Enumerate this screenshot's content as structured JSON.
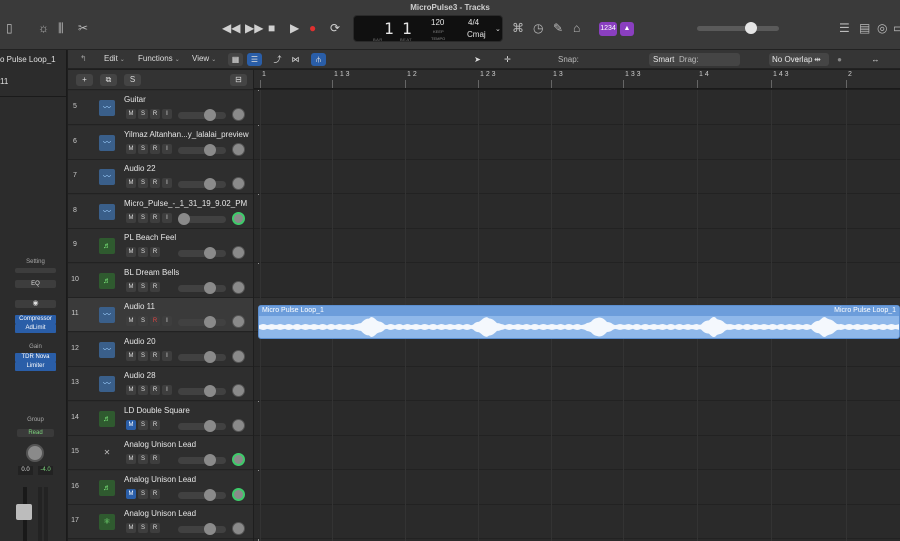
{
  "window": {
    "title": "MicroPulse3 - Tracks"
  },
  "lcd": {
    "bar": "1",
    "beat": "1",
    "bar_label": "BAR",
    "beat_label": "BEAT",
    "tempo": "120",
    "tempo_mode": "KEEP",
    "tempo_label": "TEMPO",
    "signature": "4/4",
    "key": "Cmaj"
  },
  "badge": {
    "count_in": "1234"
  },
  "inspector": {
    "region_name": "o Pulse Loop_1",
    "track_number": "11",
    "setting_label": "Setting",
    "eq_label": "EQ",
    "plugins": [
      "Compressor",
      "AdLimit"
    ],
    "gain_label": "Gain",
    "plugins2": [
      "TDR Nova",
      "Limiter"
    ],
    "group_label": "Group",
    "automation_mode": "Read",
    "volume_value": "0.0",
    "peak_value": "-4.0"
  },
  "toolbar": {
    "edit": "Edit",
    "functions": "Functions",
    "view": "View",
    "snap_label": "Snap:",
    "snap_value": "Smart",
    "drag_label": "Drag:",
    "drag_value": "No Overlap"
  },
  "track_header": {
    "add": "+",
    "solo_all": "S"
  },
  "ruler": {
    "labels": [
      {
        "text": "1"
      },
      {
        "text": "1 1 3"
      },
      {
        "text": "1 2"
      },
      {
        "text": "1 2 3"
      },
      {
        "text": "1 3"
      },
      {
        "text": "1 3 3"
      },
      {
        "text": "1 4"
      },
      {
        "text": "1 4 3"
      },
      {
        "text": "2"
      }
    ]
  },
  "tracks": [
    {
      "num": "5",
      "name": "Guitar",
      "type": "audio",
      "buttons": [
        "M",
        "S",
        "R",
        "I"
      ],
      "pan_green": false
    },
    {
      "num": "6",
      "name": "Yilmaz Altanhan...y_lalalai_preview",
      "type": "audio",
      "buttons": [
        "M",
        "S",
        "R",
        "I"
      ],
      "pan_green": false
    },
    {
      "num": "7",
      "name": "Audio 22",
      "type": "audio",
      "buttons": [
        "M",
        "S",
        "R",
        "I"
      ],
      "pan_green": false
    },
    {
      "num": "8",
      "name": "Micro_Pulse_-_1_31_19_9.02_PM",
      "type": "audio",
      "buttons": [
        "M",
        "S",
        "R",
        "I"
      ],
      "pan_green": true
    },
    {
      "num": "9",
      "name": "PL Beach Feel",
      "type": "inst",
      "buttons": [
        "M",
        "S",
        "R"
      ],
      "pan_green": false
    },
    {
      "num": "10",
      "name": "BL Dream Bells",
      "type": "inst",
      "buttons": [
        "M",
        "S",
        "R"
      ],
      "pan_green": false
    },
    {
      "num": "11",
      "name": "Audio 11",
      "type": "audio",
      "buttons": [
        "M",
        "S",
        "R",
        "I"
      ],
      "pan_green": false,
      "selected": true
    },
    {
      "num": "12",
      "name": "Audio 20",
      "type": "audio",
      "buttons": [
        "M",
        "S",
        "R",
        "I"
      ],
      "pan_green": false
    },
    {
      "num": "13",
      "name": "Audio 28",
      "type": "audio",
      "buttons": [
        "M",
        "S",
        "R",
        "I"
      ],
      "pan_green": false
    },
    {
      "num": "14",
      "name": "LD Double Square",
      "type": "inst",
      "buttons": [
        "M",
        "S",
        "R"
      ],
      "pan_green": false,
      "mute_on": true
    },
    {
      "num": "15",
      "name": "Analog Unison Lead",
      "type": "synth",
      "buttons": [
        "M",
        "S",
        "R"
      ],
      "pan_green": true
    },
    {
      "num": "16",
      "name": "Analog Unison Lead",
      "type": "inst",
      "buttons": [
        "M",
        "S",
        "R"
      ],
      "pan_green": true,
      "mute_on": true
    },
    {
      "num": "17",
      "name": "Analog Unison Lead",
      "type": "synth2",
      "buttons": [
        "M",
        "S",
        "R"
      ],
      "pan_green": false
    }
  ],
  "region": {
    "name": "Micro Pulse Loop_1",
    "name_end": "Micro Pulse Loop_1",
    "color": "#8fb8ea"
  }
}
